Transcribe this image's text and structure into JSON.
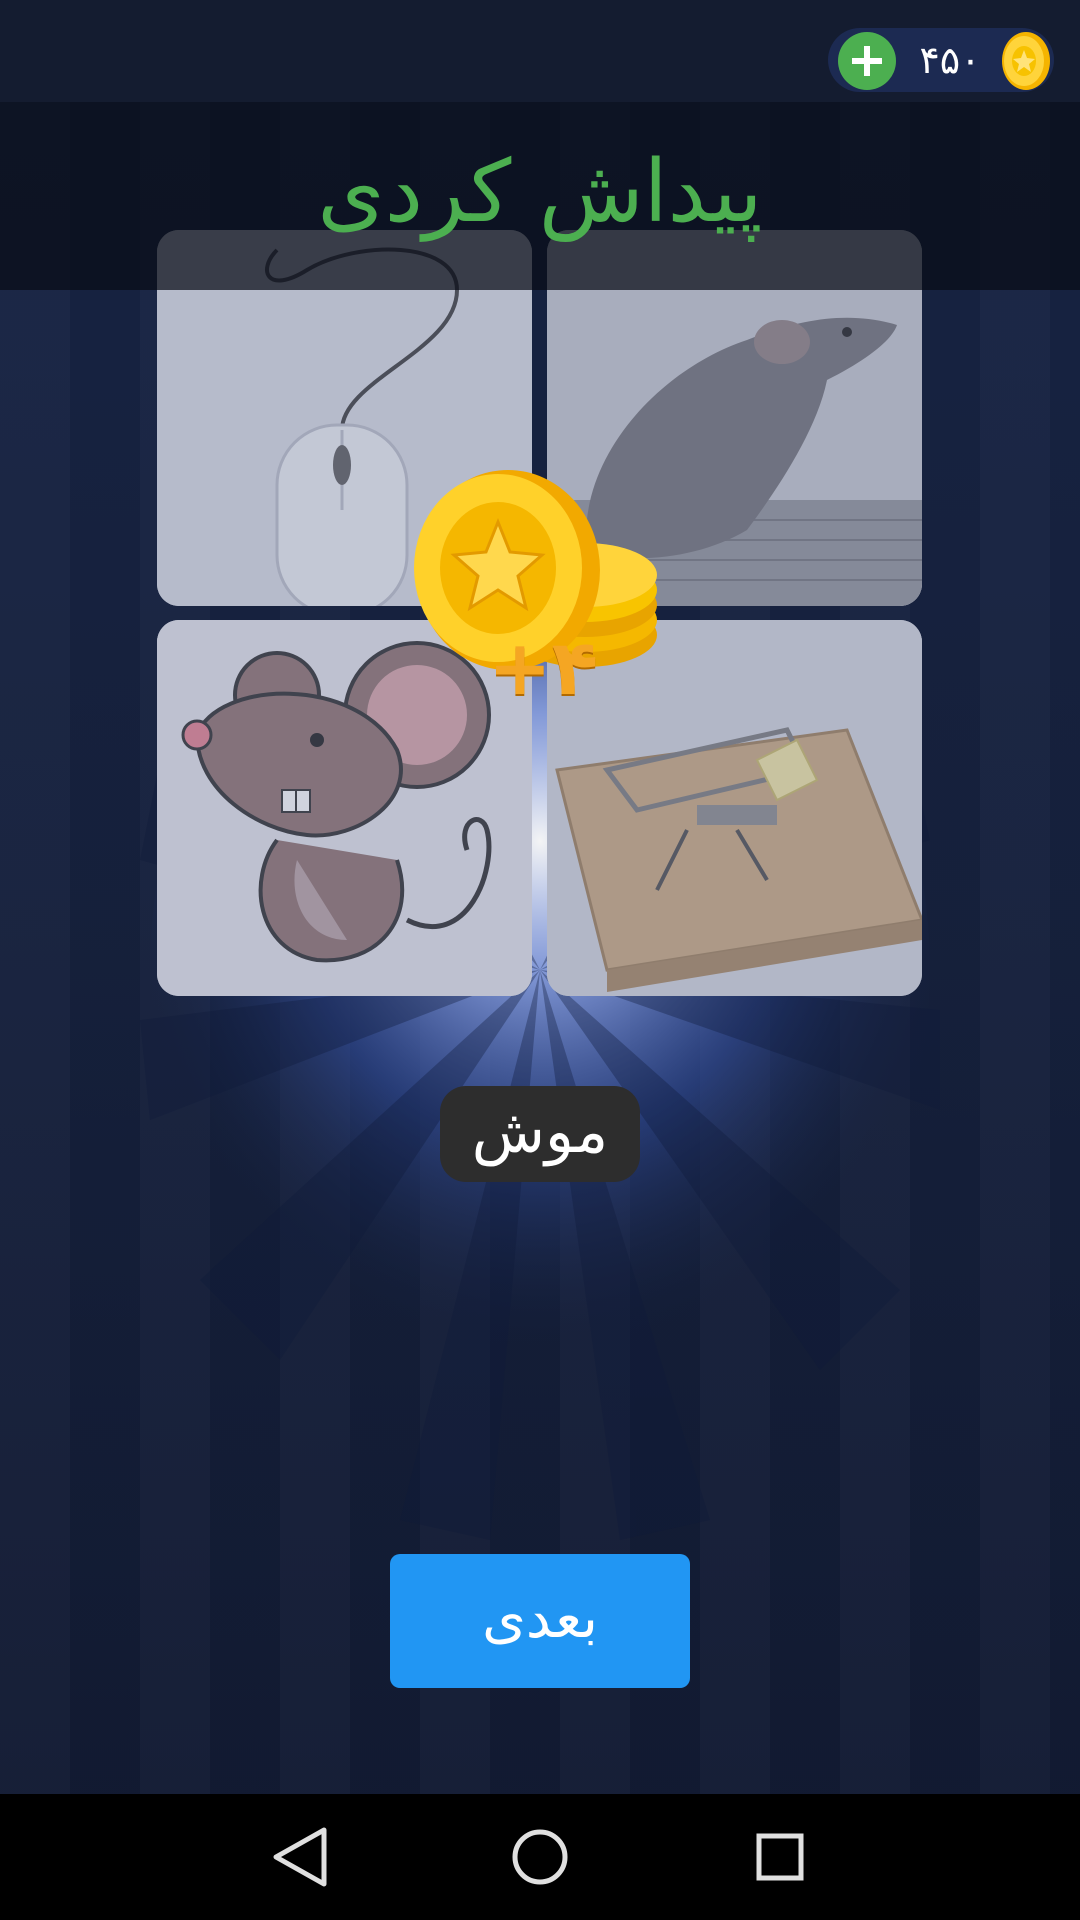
{
  "header": {
    "coin_balance": "۴۵۰",
    "add_coins_label": "+"
  },
  "banner": {
    "title": "پیداش کردی"
  },
  "puzzle": {
    "tiles": [
      {
        "icon": "computer-mouse-image"
      },
      {
        "icon": "real-mouse-image"
      },
      {
        "icon": "cartoon-mouse-image"
      },
      {
        "icon": "mousetrap-image"
      }
    ],
    "answer": "موش"
  },
  "reward": {
    "amount_text": "+۴"
  },
  "actions": {
    "next_label": "بعدی"
  },
  "navigation": {
    "back": "back-icon",
    "home": "home-icon",
    "recents": "recents-icon"
  },
  "colors": {
    "accent_green": "#4caf50",
    "button_blue": "#2196f3",
    "coin_gold": "#f5a623"
  }
}
